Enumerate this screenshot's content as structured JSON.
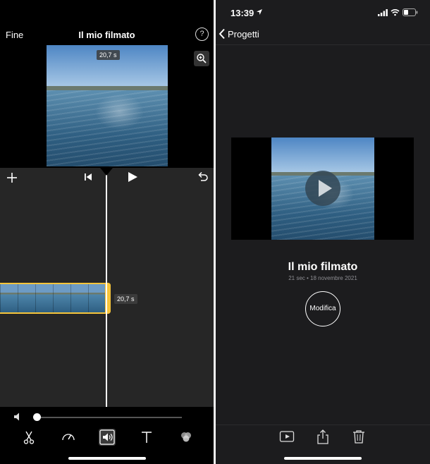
{
  "editor": {
    "done_label": "Fine",
    "title": "Il mio filmato",
    "help_glyph": "?",
    "preview_duration": "20,7 s",
    "clip_duration": "20,7 s",
    "volume_level": 0.02,
    "icons": [
      "zoom-icon",
      "add-icon",
      "skip-to-start-icon",
      "play-icon",
      "undo-icon",
      "mute-icon",
      "scissors-icon",
      "speed-icon",
      "volume-icon",
      "text-icon",
      "filters-icon"
    ],
    "active_tool": "volume",
    "accent_color": "#f6c43a"
  },
  "project": {
    "status_time": "13:39",
    "back_label": "Progetti",
    "title": "Il mio filmato",
    "meta": "21 sec • 18 novembre 2021",
    "edit_label": "Modifica",
    "icons": [
      "location-arrow-icon",
      "signal-icon",
      "wifi-icon",
      "battery-icon",
      "back-chevron-icon",
      "play-icon",
      "play-video-icon",
      "share-icon",
      "trash-icon"
    ]
  }
}
